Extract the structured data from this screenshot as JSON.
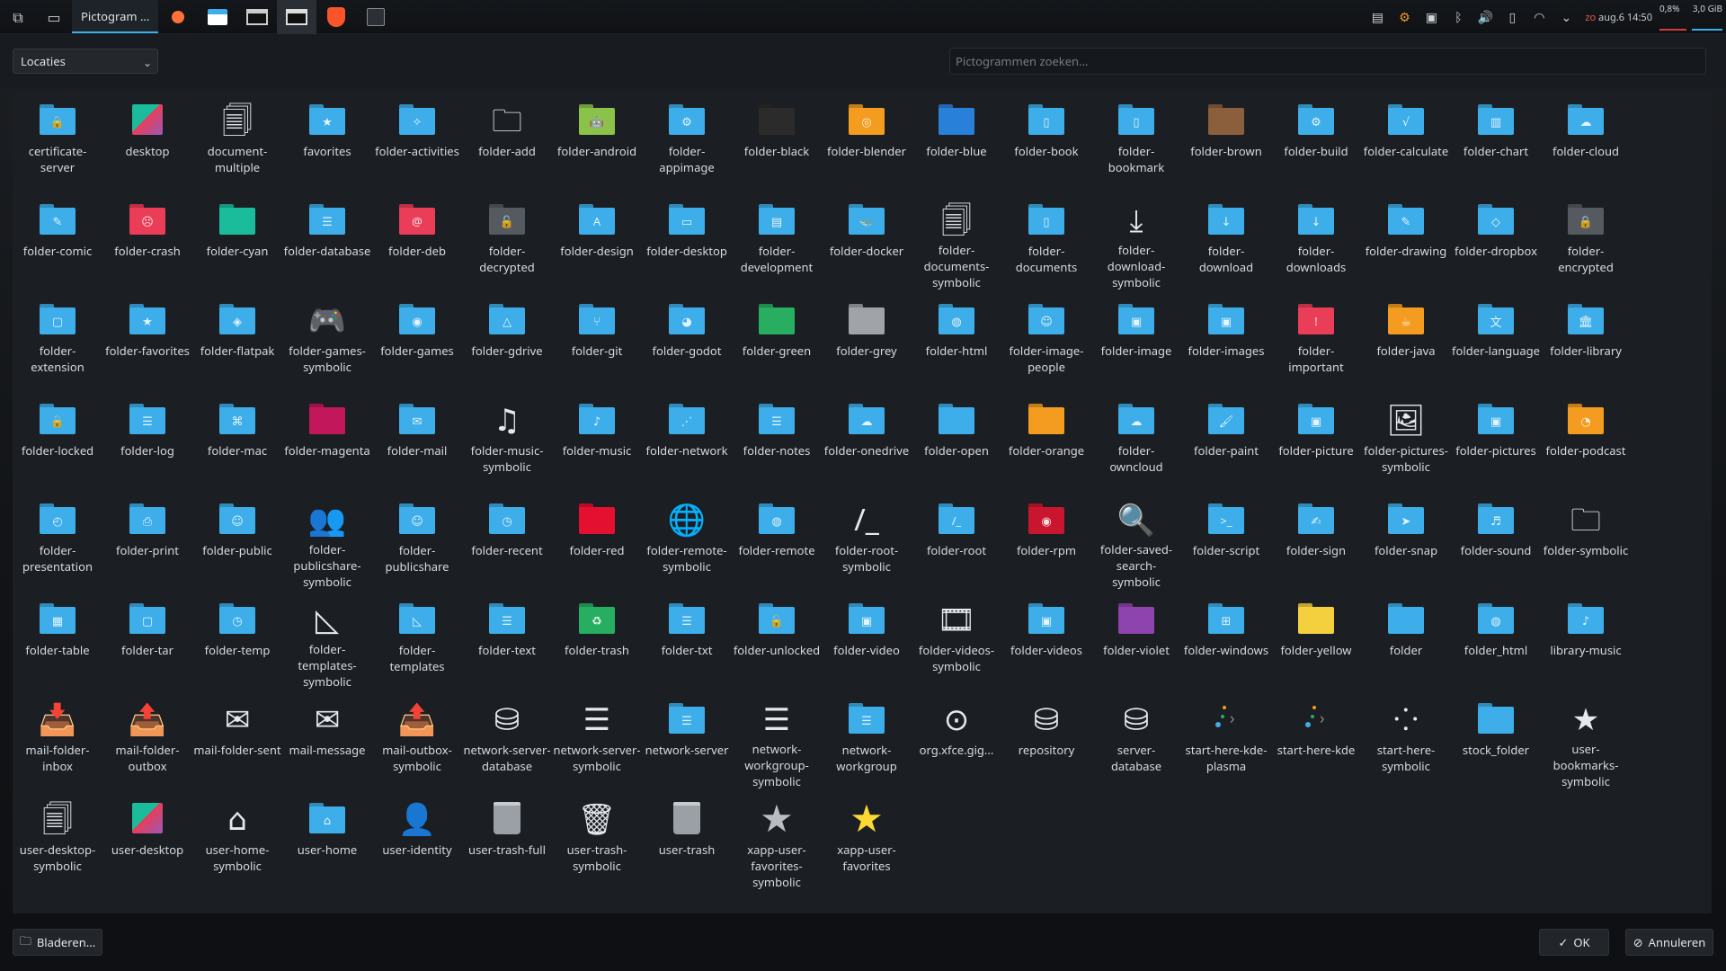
{
  "panel": {
    "task_title": "Pictogram ...",
    "clock": "zo aug.6 14:50",
    "clock_prefix": "zo",
    "clock_time": "aug.6 14:50",
    "cpu": "0,8%",
    "mem": "3,0 GiB"
  },
  "dialog": {
    "location_select": "Locaties",
    "search_placeholder": "Pictogrammen zoeken...",
    "browse_label": "Bladeren...",
    "ok_label": "OK",
    "cancel_label": "Annuleren"
  },
  "icons": [
    {
      "label": "certificate-server",
      "type": "folder",
      "color": "#3daee9",
      "glyph": "🔒"
    },
    {
      "label": "desktop",
      "type": "desktop"
    },
    {
      "label": "document-multiple",
      "type": "sym",
      "glyph": "🗐"
    },
    {
      "label": "favorites",
      "type": "folder",
      "color": "#3daee9",
      "glyph": "★"
    },
    {
      "label": "folder-activities",
      "type": "folder",
      "color": "#3daee9",
      "glyph": "✧"
    },
    {
      "label": "folder-add",
      "type": "sym",
      "glyph": "🗀"
    },
    {
      "label": "folder-android",
      "type": "folder",
      "color": "#8bc34a",
      "glyph": "🤖"
    },
    {
      "label": "folder-appimage",
      "type": "folder",
      "color": "#3daee9",
      "glyph": "⚙"
    },
    {
      "label": "folder-black",
      "type": "folder",
      "color": "#2b2b2b",
      "glyph": ""
    },
    {
      "label": "folder-blender",
      "type": "folder",
      "color": "#f39c1f",
      "glyph": "◎"
    },
    {
      "label": "folder-blue",
      "type": "folder",
      "color": "#2980d9",
      "glyph": ""
    },
    {
      "label": "folder-book",
      "type": "folder",
      "color": "#3daee9",
      "glyph": "▯"
    },
    {
      "label": "folder-bookmark",
      "type": "folder",
      "color": "#3daee9",
      "glyph": "▯"
    },
    {
      "label": "folder-brown",
      "type": "folder",
      "color": "#8b5e3c",
      "glyph": ""
    },
    {
      "label": "folder-build",
      "type": "folder",
      "color": "#3daee9",
      "glyph": "⚙"
    },
    {
      "label": "folder-calculate",
      "type": "folder",
      "color": "#3daee9",
      "glyph": "√"
    },
    {
      "label": "folder-chart",
      "type": "folder",
      "color": "#3daee9",
      "glyph": "▥"
    },
    {
      "label": "folder-cloud",
      "type": "folder",
      "color": "#3daee9",
      "glyph": "☁"
    },
    {
      "label": "folder-comic",
      "type": "folder",
      "color": "#3daee9",
      "glyph": "✎"
    },
    {
      "label": "folder-crash",
      "type": "folder",
      "color": "#e93d58",
      "glyph": "☹"
    },
    {
      "label": "folder-cyan",
      "type": "folder",
      "color": "#1abc9c",
      "glyph": ""
    },
    {
      "label": "folder-database",
      "type": "folder",
      "color": "#3daee9",
      "glyph": "☰"
    },
    {
      "label": "folder-deb",
      "type": "folder",
      "color": "#e93d58",
      "glyph": "@"
    },
    {
      "label": "folder-decrypted",
      "type": "folder",
      "color": "#555a60",
      "glyph": "🔓"
    },
    {
      "label": "folder-design",
      "type": "folder",
      "color": "#3daee9",
      "glyph": "A"
    },
    {
      "label": "folder-desktop",
      "type": "folder",
      "color": "#3daee9",
      "glyph": "▭"
    },
    {
      "label": "folder-development",
      "type": "folder",
      "color": "#3daee9",
      "glyph": "▤"
    },
    {
      "label": "folder-docker",
      "type": "folder",
      "color": "#3daee9",
      "glyph": "🐳"
    },
    {
      "label": "folder-documents-symbolic",
      "type": "sym",
      "glyph": "🗐"
    },
    {
      "label": "folder-documents",
      "type": "folder",
      "color": "#3daee9",
      "glyph": "▯"
    },
    {
      "label": "folder-download-symbolic",
      "type": "sym",
      "glyph": "⤓"
    },
    {
      "label": "folder-download",
      "type": "folder",
      "color": "#3daee9",
      "glyph": "↓"
    },
    {
      "label": "folder-downloads",
      "type": "folder",
      "color": "#3daee9",
      "glyph": "↓"
    },
    {
      "label": "folder-drawing",
      "type": "folder",
      "color": "#3daee9",
      "glyph": "✎"
    },
    {
      "label": "folder-dropbox",
      "type": "folder",
      "color": "#3daee9",
      "glyph": "◇"
    },
    {
      "label": "folder-encrypted",
      "type": "folder",
      "color": "#555a60",
      "glyph": "🔒"
    },
    {
      "label": "folder-extension",
      "type": "folder",
      "color": "#3daee9",
      "glyph": "▢"
    },
    {
      "label": "folder-favorites",
      "type": "folder",
      "color": "#3daee9",
      "glyph": "★"
    },
    {
      "label": "folder-flatpak",
      "type": "folder",
      "color": "#3daee9",
      "glyph": "◈"
    },
    {
      "label": "folder-games-symbolic",
      "type": "sym",
      "glyph": "🎮"
    },
    {
      "label": "folder-games",
      "type": "folder",
      "color": "#3daee9",
      "glyph": "◉"
    },
    {
      "label": "folder-gdrive",
      "type": "folder",
      "color": "#3daee9",
      "glyph": "△"
    },
    {
      "label": "folder-git",
      "type": "folder",
      "color": "#3daee9",
      "glyph": "⑂"
    },
    {
      "label": "folder-godot",
      "type": "folder",
      "color": "#3daee9",
      "glyph": "◕"
    },
    {
      "label": "folder-green",
      "type": "folder",
      "color": "#27ae60",
      "glyph": ""
    },
    {
      "label": "folder-grey",
      "type": "folder",
      "color": "#a0a4a8",
      "glyph": ""
    },
    {
      "label": "folder-html",
      "type": "folder",
      "color": "#3daee9",
      "glyph": "◍"
    },
    {
      "label": "folder-image-people",
      "type": "folder",
      "color": "#3daee9",
      "glyph": "☺"
    },
    {
      "label": "folder-image",
      "type": "folder",
      "color": "#3daee9",
      "glyph": "▣"
    },
    {
      "label": "folder-images",
      "type": "folder",
      "color": "#3daee9",
      "glyph": "▣"
    },
    {
      "label": "folder-important",
      "type": "folder",
      "color": "#e93d58",
      "glyph": "!"
    },
    {
      "label": "folder-java",
      "type": "folder",
      "color": "#f39c1f",
      "glyph": "☕"
    },
    {
      "label": "folder-language",
      "type": "folder",
      "color": "#3daee9",
      "glyph": "文"
    },
    {
      "label": "folder-library",
      "type": "folder",
      "color": "#3daee9",
      "glyph": "🏛"
    },
    {
      "label": "folder-locked",
      "type": "folder",
      "color": "#3daee9",
      "glyph": "🔒"
    },
    {
      "label": "folder-log",
      "type": "folder",
      "color": "#3daee9",
      "glyph": "☰"
    },
    {
      "label": "folder-mac",
      "type": "folder",
      "color": "#3daee9",
      "glyph": "⌘"
    },
    {
      "label": "folder-magenta",
      "type": "folder",
      "color": "#c2185b",
      "glyph": ""
    },
    {
      "label": "folder-mail",
      "type": "folder",
      "color": "#3daee9",
      "glyph": "✉"
    },
    {
      "label": "folder-music-symbolic",
      "type": "sym",
      "glyph": "♫"
    },
    {
      "label": "folder-music",
      "type": "folder",
      "color": "#3daee9",
      "glyph": "♪"
    },
    {
      "label": "folder-network",
      "type": "folder",
      "color": "#3daee9",
      "glyph": "⋰"
    },
    {
      "label": "folder-notes",
      "type": "folder",
      "color": "#3daee9",
      "glyph": "☰"
    },
    {
      "label": "folder-onedrive",
      "type": "folder",
      "color": "#3daee9",
      "glyph": "☁"
    },
    {
      "label": "folder-open",
      "type": "folder",
      "color": "#3daee9",
      "glyph": ""
    },
    {
      "label": "folder-orange",
      "type": "folder",
      "color": "#f39c1f",
      "glyph": ""
    },
    {
      "label": "folder-owncloud",
      "type": "folder",
      "color": "#3daee9",
      "glyph": "☁"
    },
    {
      "label": "folder-paint",
      "type": "folder",
      "color": "#3daee9",
      "glyph": "🖌"
    },
    {
      "label": "folder-picture",
      "type": "folder",
      "color": "#3daee9",
      "glyph": "▣"
    },
    {
      "label": "folder-pictures-symbolic",
      "type": "sym",
      "glyph": "🖼"
    },
    {
      "label": "folder-pictures",
      "type": "folder",
      "color": "#3daee9",
      "glyph": "▣"
    },
    {
      "label": "folder-podcast",
      "type": "folder",
      "color": "#f39c1f",
      "glyph": "◔"
    },
    {
      "label": "folder-presentation",
      "type": "folder",
      "color": "#3daee9",
      "glyph": "◴"
    },
    {
      "label": "folder-print",
      "type": "folder",
      "color": "#3daee9",
      "glyph": "⎙"
    },
    {
      "label": "folder-public",
      "type": "folder",
      "color": "#3daee9",
      "glyph": "☺"
    },
    {
      "label": "folder-publicshare-symbolic",
      "type": "sym",
      "glyph": "👥"
    },
    {
      "label": "folder-publicshare",
      "type": "folder",
      "color": "#3daee9",
      "glyph": "☺"
    },
    {
      "label": "folder-recent",
      "type": "folder",
      "color": "#3daee9",
      "glyph": "◷"
    },
    {
      "label": "folder-red",
      "type": "folder",
      "color": "#e3102f",
      "glyph": ""
    },
    {
      "label": "folder-remote-symbolic",
      "type": "sym",
      "glyph": "🌐"
    },
    {
      "label": "folder-remote",
      "type": "folder",
      "color": "#3daee9",
      "glyph": "◍"
    },
    {
      "label": "folder-root-symbolic",
      "type": "sym",
      "glyph": "/_"
    },
    {
      "label": "folder-root",
      "type": "folder",
      "color": "#3daee9",
      "glyph": "/_"
    },
    {
      "label": "folder-rpm",
      "type": "folder",
      "color": "#c9162e",
      "glyph": "◉"
    },
    {
      "label": "folder-saved-search-symbolic",
      "type": "sym",
      "glyph": "🔍"
    },
    {
      "label": "folder-script",
      "type": "folder",
      "color": "#3daee9",
      "glyph": ">_"
    },
    {
      "label": "folder-sign",
      "type": "folder",
      "color": "#3daee9",
      "glyph": "✍"
    },
    {
      "label": "folder-snap",
      "type": "folder",
      "color": "#3daee9",
      "glyph": "➤"
    },
    {
      "label": "folder-sound",
      "type": "folder",
      "color": "#3daee9",
      "glyph": "♬"
    },
    {
      "label": "folder-symbolic",
      "type": "sym",
      "glyph": "🗀"
    },
    {
      "label": "folder-table",
      "type": "folder",
      "color": "#3daee9",
      "glyph": "▦"
    },
    {
      "label": "folder-tar",
      "type": "folder",
      "color": "#3daee9",
      "glyph": "▢"
    },
    {
      "label": "folder-temp",
      "type": "folder",
      "color": "#3daee9",
      "glyph": "◷"
    },
    {
      "label": "folder-templates-symbolic",
      "type": "sym",
      "glyph": "◺"
    },
    {
      "label": "folder-templates",
      "type": "folder",
      "color": "#3daee9",
      "glyph": "◺"
    },
    {
      "label": "folder-text",
      "type": "folder",
      "color": "#3daee9",
      "glyph": "☰"
    },
    {
      "label": "folder-trash",
      "type": "folder",
      "color": "#27ae60",
      "glyph": "♻"
    },
    {
      "label": "folder-txt",
      "type": "folder",
      "color": "#3daee9",
      "glyph": "☰"
    },
    {
      "label": "folder-unlocked",
      "type": "folder",
      "color": "#3daee9",
      "glyph": "🔓"
    },
    {
      "label": "folder-video",
      "type": "folder",
      "color": "#3daee9",
      "glyph": "▣"
    },
    {
      "label": "folder-videos-symbolic",
      "type": "sym",
      "glyph": "🎞"
    },
    {
      "label": "folder-videos",
      "type": "folder",
      "color": "#3daee9",
      "glyph": "▣"
    },
    {
      "label": "folder-violet",
      "type": "folder",
      "color": "#8e44ad",
      "glyph": ""
    },
    {
      "label": "folder-windows",
      "type": "folder",
      "color": "#3daee9",
      "glyph": "⊞"
    },
    {
      "label": "folder-yellow",
      "type": "folder",
      "color": "#f4d03f",
      "glyph": ""
    },
    {
      "label": "folder",
      "type": "folder",
      "color": "#3daee9",
      "glyph": ""
    },
    {
      "label": "folder_html",
      "type": "folder",
      "color": "#3daee9",
      "glyph": "◍"
    },
    {
      "label": "library-music",
      "type": "folder",
      "color": "#3daee9",
      "glyph": "♪"
    },
    {
      "label": "mail-folder-inbox",
      "type": "sym",
      "glyph": "📥"
    },
    {
      "label": "mail-folder-outbox",
      "type": "sym",
      "glyph": "📤"
    },
    {
      "label": "mail-folder-sent",
      "type": "sym",
      "glyph": "✉"
    },
    {
      "label": "mail-message",
      "type": "sym",
      "glyph": "✉"
    },
    {
      "label": "mail-outbox-symbolic",
      "type": "sym",
      "glyph": "📤"
    },
    {
      "label": "network-server-database",
      "type": "sym",
      "glyph": "⛁"
    },
    {
      "label": "network-server-symbolic",
      "type": "sym",
      "glyph": "☰"
    },
    {
      "label": "network-server",
      "type": "folder",
      "color": "#3daee9",
      "glyph": "☰"
    },
    {
      "label": "network-workgroup-symbolic",
      "type": "sym",
      "glyph": "☰"
    },
    {
      "label": "network-workgroup",
      "type": "folder",
      "color": "#3daee9",
      "glyph": "☰"
    },
    {
      "label": "org.xfce.gig...",
      "type": "sym",
      "glyph": "⊙"
    },
    {
      "label": "repository",
      "type": "sym",
      "glyph": "⛁"
    },
    {
      "label": "server-database",
      "type": "sym",
      "glyph": "⛁"
    },
    {
      "label": "start-here-kde-plasma",
      "type": "kde"
    },
    {
      "label": "start-here-kde",
      "type": "kde"
    },
    {
      "label": "start-here-symbolic",
      "type": "sym",
      "glyph": "⁘"
    },
    {
      "label": "stock_folder",
      "type": "folder",
      "color": "#3daee9",
      "glyph": ""
    },
    {
      "label": "user-bookmarks-symbolic",
      "type": "sym",
      "glyph": "★"
    },
    {
      "label": "user-desktop-symbolic",
      "type": "sym",
      "glyph": "🗐"
    },
    {
      "label": "user-desktop",
      "type": "desktop"
    },
    {
      "label": "user-home-symbolic",
      "type": "sym",
      "glyph": "⌂"
    },
    {
      "label": "user-home",
      "type": "folder",
      "color": "#3daee9",
      "glyph": "⌂"
    },
    {
      "label": "user-identity",
      "type": "sym",
      "glyph": "👤"
    },
    {
      "label": "user-trash-full",
      "type": "trash",
      "color": "#9aa0a6"
    },
    {
      "label": "user-trash-symbolic",
      "type": "sym",
      "glyph": "🗑"
    },
    {
      "label": "user-trash",
      "type": "trash",
      "color": "#9aa0a6"
    },
    {
      "label": "xapp-user-favorites-symbolic",
      "type": "star",
      "color": "#b9bdc2"
    },
    {
      "label": "xapp-user-favorites",
      "type": "star",
      "color": "#fdd835"
    }
  ]
}
